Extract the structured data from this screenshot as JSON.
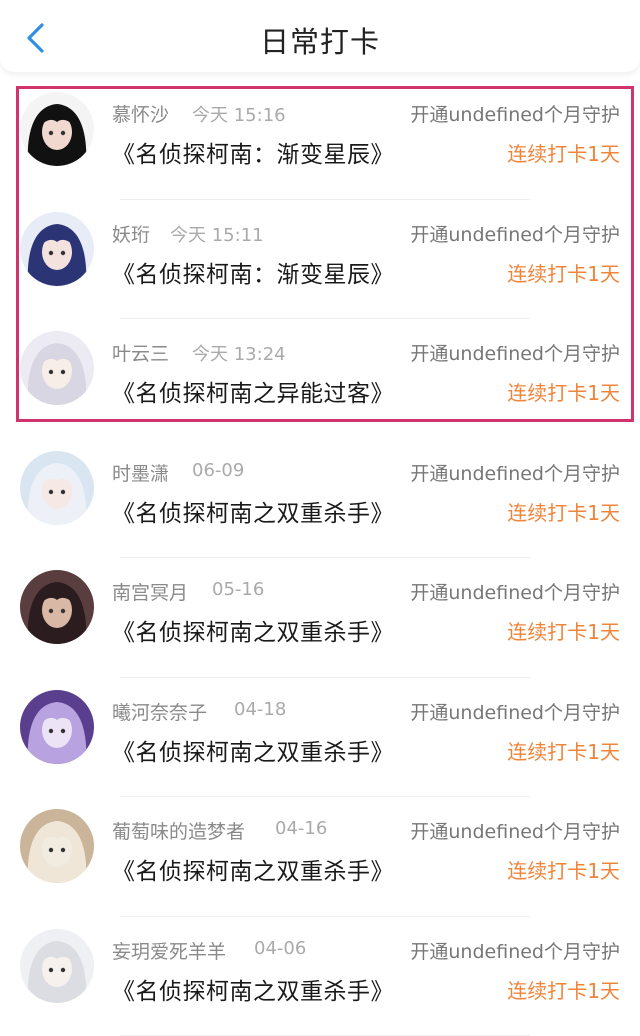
{
  "header": {
    "title": "日常打卡"
  },
  "items": [
    {
      "name": "慕怀沙",
      "time": "今天 15:16",
      "guard": "开通undefined个月守护",
      "work": "《名侦探柯南：渐变星辰》",
      "streak": "连续打卡1天",
      "avatar": {
        "bg": "#f4f4f4",
        "hair": "#111111",
        "skin": "#f2d9cf"
      }
    },
    {
      "name": "妖珩",
      "time": "今天 15:11",
      "guard": "开通undefined个月守护",
      "work": "《名侦探柯南：渐变星辰》",
      "streak": "连续打卡1天",
      "avatar": {
        "bg": "#e8ecf7",
        "hair": "#2b3576",
        "skin": "#f3e2dd"
      }
    },
    {
      "name": "叶云三",
      "time": "今天 13:24",
      "guard": "开通undefined个月守护",
      "work": "《名侦探柯南之异能过客》",
      "streak": "连续打卡1天",
      "avatar": {
        "bg": "#eceaf2",
        "hair": "#d8d6e2",
        "skin": "#f8eee8"
      }
    },
    {
      "name": "时墨潇",
      "time": "06-09",
      "guard": "开通undefined个月守护",
      "work": "《名侦探柯南之双重杀手》",
      "streak": "连续打卡1天",
      "avatar": {
        "bg": "#d9e6f2",
        "hair": "#edf1f7",
        "skin": "#f6e8e4"
      }
    },
    {
      "name": "南宫冥月",
      "time": "05-16",
      "guard": "开通undefined个月守护",
      "work": "《名侦探柯南之双重杀手》",
      "streak": "连续打卡1天",
      "avatar": {
        "bg": "#5a3d3e",
        "hair": "#2a1c1f",
        "skin": "#d9b8a6"
      }
    },
    {
      "name": "曦河奈奈子",
      "time": "04-18",
      "guard": "开通undefined个月守护",
      "work": "《名侦探柯南之双重杀手》",
      "streak": "连续打卡1天",
      "avatar": {
        "bg": "#5b3f8f",
        "hair": "#b8a2e0",
        "skin": "#ece4f6"
      }
    },
    {
      "name": "葡萄味的造梦者",
      "time": "04-16",
      "guard": "开通undefined个月守护",
      "work": "《名侦探柯南之双重杀手》",
      "streak": "连续打卡1天",
      "avatar": {
        "bg": "#cbb59a",
        "hair": "#efe6d8",
        "skin": "#f2ebe0"
      }
    },
    {
      "name": "妄玥爱死羊羊",
      "time": "04-06",
      "guard": "开通undefined个月守护",
      "work": "《名侦探柯南之双重杀手》",
      "streak": "连续打卡1天",
      "avatar": {
        "bg": "#eef0f3",
        "hair": "#dcdde3",
        "skin": "#f7f1ee"
      }
    }
  ],
  "colors": {
    "accent_blue": "#2f8fe8",
    "streak_orange": "#f0843a",
    "highlight": "#d1346d"
  }
}
